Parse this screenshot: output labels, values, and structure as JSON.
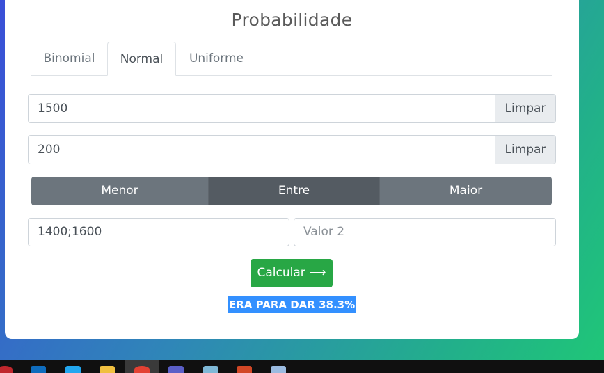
{
  "title": "Probabilidade",
  "tabs": [
    {
      "label": "Binomial",
      "active": false
    },
    {
      "label": "Normal",
      "active": true
    },
    {
      "label": "Uniforme",
      "active": false
    }
  ],
  "inputs": {
    "mean": {
      "value": "1500",
      "clear_label": "Limpar"
    },
    "std": {
      "value": "200",
      "clear_label": "Limpar"
    }
  },
  "comparison": {
    "options": [
      "Menor",
      "Entre",
      "Maior"
    ],
    "selected": "Entre"
  },
  "values": {
    "value1": "1400;1600",
    "value2_placeholder": "Valor 2"
  },
  "calculate_label": "Calcular ⟶",
  "result_text": "ERA PARA DAR 38.3%",
  "taskbar": {
    "icons": [
      "opera-icon",
      "outlook-icon",
      "vscode-icon",
      "file-explorer-icon",
      "chrome-icon",
      "teams-icon",
      "notepad-icon",
      "powerpoint-icon",
      "document-icon"
    ],
    "colors": [
      "#c0272d",
      "#0f6cbd",
      "#22a7f0",
      "#f0c040",
      "#e34133",
      "#5b5fc7",
      "#7fb8d6",
      "#d24726",
      "#9bbbe0"
    ]
  }
}
